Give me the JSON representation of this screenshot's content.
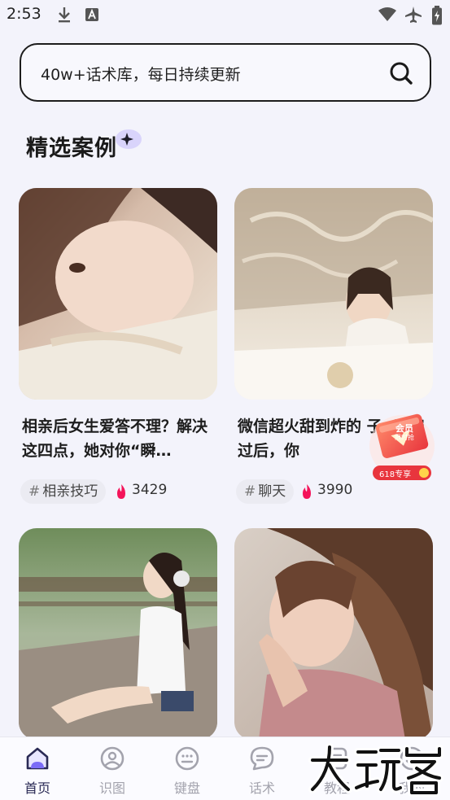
{
  "status_bar": {
    "time": "2:53"
  },
  "search": {
    "text": "40w+话术库，每日持续更新"
  },
  "section": {
    "title": "精选案例"
  },
  "cards": [
    {
      "title": "相亲后女生爱答不理？解决这四点，她对你“瞬…",
      "tag": "相亲技巧",
      "hot": "3429"
    },
    {
      "title": "微信超火甜到炸的 子: 晚安过后，你 ",
      "tag": "聊天",
      "hot": "3990"
    },
    {
      "title": "",
      "tag": "",
      "hot": ""
    },
    {
      "title": "",
      "tag": "",
      "hot": ""
    }
  ],
  "promo": {
    "line1": "会员",
    "line2": "限时抢",
    "badge": "618专享"
  },
  "tabs": [
    {
      "label": "首页",
      "icon": "home-icon"
    },
    {
      "label": "识图",
      "icon": "image-recognition-icon"
    },
    {
      "label": "键盘",
      "icon": "keyboard-icon"
    },
    {
      "label": "话术",
      "icon": "chat-bubble-icon"
    },
    {
      "label": "教程",
      "icon": "tutorial-icon"
    },
    {
      "label": "我的",
      "icon": "profile-icon"
    }
  ],
  "watermark": {
    "text": "大玩家"
  },
  "colors": {
    "accent": "#2a2a55",
    "hot": "#f4145a",
    "background": "#f3f3fb"
  }
}
